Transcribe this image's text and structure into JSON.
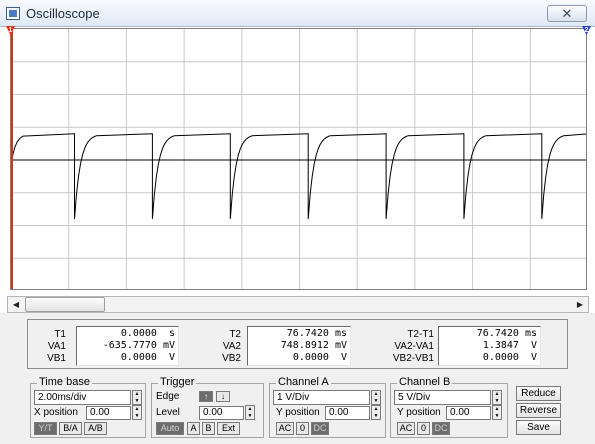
{
  "window": {
    "title": "Oscilloscope",
    "close_glyph": "✕",
    "icon": "oscilloscope-app-icon"
  },
  "screen": {
    "background": "#ffffff",
    "grid_color": "#c8c8c8",
    "trace_color": "#000000",
    "cursor1_color": "#e03010",
    "cursor2_color": "#2040d0",
    "cursor1_label": "1",
    "cursor2_label": "2",
    "horizontal_divisions": 10,
    "vertical_divisions": 8
  },
  "waveform": {
    "period_divisions": 1.35,
    "first_drop_division": 1.1,
    "high_level_divisions": 0.8,
    "low_level_divisions": -1.8,
    "rise_time_divisions": 0.4
  },
  "readouts": {
    "cursor1": {
      "labels": [
        "T1",
        "VA1",
        "VB1"
      ],
      "values": [
        "0.0000  s",
        "-635.7770 mV",
        "0.0000  V"
      ]
    },
    "cursor2": {
      "labels": [
        "T2",
        "VA2",
        "VB2"
      ],
      "values": [
        "76.7420 ms",
        "748.8912 mV",
        "0.0000  V"
      ]
    },
    "delta": {
      "labels": [
        "T2-T1",
        "VA2-VA1",
        "VB2-VB1"
      ],
      "values": [
        "76.7420 ms",
        "1.3847  V",
        "0.0000  V"
      ]
    }
  },
  "timebase": {
    "title": "Time base",
    "scale": "2.00ms/div",
    "xpos_label": "X position",
    "xpos_value": "0.00",
    "modes": [
      "Y/T",
      "B/A",
      "A/B"
    ],
    "active_mode": "Y/T"
  },
  "trigger": {
    "title": "Trigger",
    "edge_label": "Edge",
    "edge_rising_glyph": "↑",
    "edge_falling_glyph": "↓",
    "level_label": "Level",
    "level_value": "0.00",
    "sources": [
      "Auto",
      "A",
      "B",
      "Ext"
    ],
    "active_source": "Auto"
  },
  "channel_a": {
    "title": "Channel A",
    "scale": "1 V/Div",
    "ypos_label": "Y position",
    "ypos_value": "0.00",
    "coupling": [
      "AC",
      "0",
      "DC"
    ],
    "active_coupling": "DC"
  },
  "channel_b": {
    "title": "Channel B",
    "scale": "5 V/Div",
    "ypos_label": "Y position",
    "ypos_value": "0.00",
    "coupling": [
      "AC",
      "0",
      "DC"
    ],
    "active_coupling": "DC"
  },
  "actions": {
    "reduce": "Reduce",
    "reverse": "Reverse",
    "save": "Save"
  },
  "spin": {
    "up": "▲",
    "down": "▼"
  },
  "scroll": {
    "left": "◀",
    "right": "▶"
  }
}
